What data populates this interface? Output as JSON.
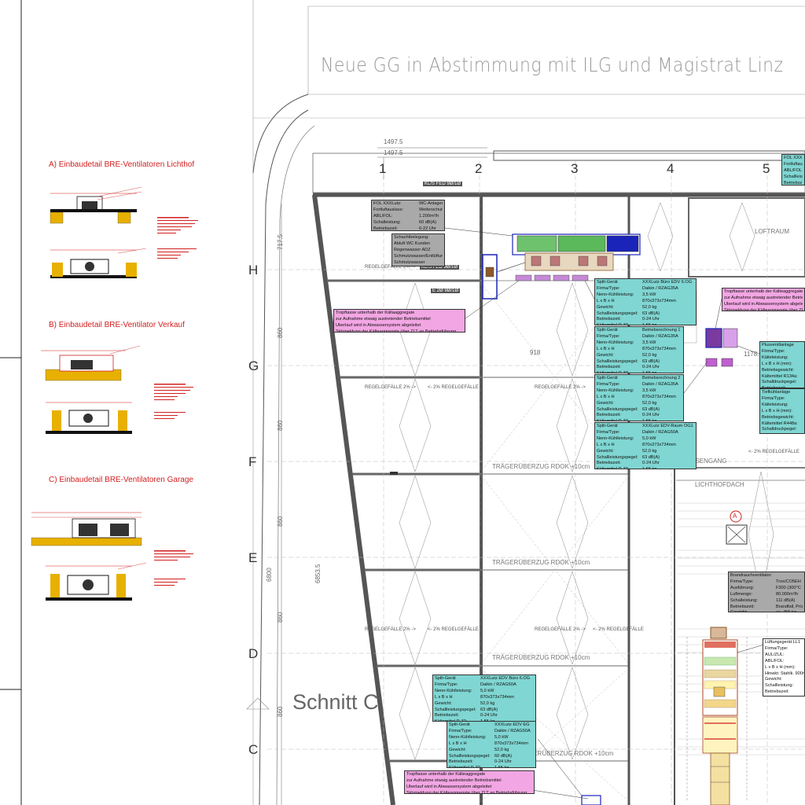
{
  "headline": "Neue GG in Abstimmung mit ILG und Magistrat Linz",
  "section_title": "Schnitt C",
  "details": [
    {
      "title": "A) Einbaudetail BRE-Ventilatoren Lichthof"
    },
    {
      "title": "B) Einbaudetail BRE-Ventilator Verkauf"
    },
    {
      "title": "C) Einbaudetail BRE-Ventilatoren Garage"
    }
  ],
  "grid_columns": [
    "1",
    "2",
    "3",
    "4",
    "5"
  ],
  "grid_rows": [
    "H",
    "G",
    "F",
    "E",
    "D",
    "C"
  ],
  "dimensions": {
    "top_a": "1497.5",
    "top_b": "1497.5",
    "left_a": "717.5",
    "left_b": "860",
    "left_c": "860",
    "left_d": "860",
    "left_e": "860",
    "left_f": "860",
    "left_total": "6800",
    "left_total2": "6853.5",
    "mid": "918",
    "right": "1178.5"
  },
  "labels": {
    "regel_left": "REGELGEFÄLLE 2% ->",
    "regel_right": "<- 2% REGELGEFÄLLE",
    "traeger1": "TRÄGERÜBERZUG RDOK +10cm",
    "traeger2": "TRÄGERÜBERZUG RDOK +10cm",
    "traeger3": "TRÄGERÜBERZUG RDOK +10cm",
    "traeger4": "TRÄGERÜBERZUG RDOK +10cm",
    "lichthof": "LICHTHOFDACH",
    "aussengang": "AUSSENGANG",
    "loftraum": "LOFTRAUM",
    "marker_a": "A",
    "tag_top": "KL/S  FED 9Ø/1Ø",
    "tag_mid": "KL/S  FED 9Ø/1Ø",
    "tag_low": "E 2Ø 9Ø/1Ø"
  },
  "boxes": {
    "fol_wc": {
      "rows": [
        [
          "FOL XXXLutz:",
          "WC-Anlagen"
        ],
        [
          "Fortluftauslass:",
          "Wetterschutzgitter"
        ],
        [
          "ABL/FOL:",
          "1.200m³/h"
        ],
        [
          "Schalleistung:",
          "60 dB(A)"
        ],
        [
          "Betriebszeit:",
          "6-22 Uhr"
        ]
      ]
    },
    "schacht": {
      "lines": [
        "Schachtbelegung:",
        "Abluft WC Kunden",
        "Regenwasser ADZ",
        "Schmutzwasser/Entlüftung",
        "Schmutzwasser"
      ]
    },
    "tropf_top": {
      "lines": [
        "Tropftasse unterhalb der Kältaaggregate",
        "zur Aufnahme etwaig austretender Betriebsmittel",
        "Überlauf wird in Abwassersystem abgeleitet",
        "Störmeldung der Kälteaggregate über ZLT an Betriebsführung"
      ]
    },
    "tropf_right": {
      "lines": [
        "Tropftasse unterhalb der Kälteaggregate",
        "zur Aufnahme etwaig austretender Betriebsmittel",
        "Überlauf wird in Abwassersystem abgeleitet",
        "Störmeldung der Kälteaggregate über ZLT an"
      ]
    },
    "tropf_bottom": {
      "lines": [
        "Tropftasse unterhalb der Kälteaggregate",
        "zur Aufnahme etwaig austretender Betriebsmittel",
        "Überlauf wird in Abwassersystem abgeleitet",
        "Störmeldung der Kälteaggregate über ZLT an Betriebsführung"
      ]
    },
    "split1": {
      "rows": [
        [
          "Split-Gerät",
          "XXXLutz Büro EDV 6.OG"
        ],
        [
          "Firma/Type:",
          "Daikin / RZAG35A"
        ],
        [
          "Nenn-Kühlleistung:",
          "3,5 kW"
        ],
        [
          "L x B x H",
          "870x373x734mm"
        ],
        [
          "Gewicht:",
          "52,0 kg"
        ],
        [
          "Schallleistungspegel:",
          "63 dB(A)"
        ],
        [
          "Betriebszeit:",
          "0-24 Uhr"
        ],
        [
          "Kältemittel R-32:",
          "1,55 kg"
        ]
      ]
    },
    "split2": {
      "rows": [
        [
          "Split-Gerät",
          "Betriebsrechnung 1"
        ],
        [
          "Firma/Type:",
          "Daikin / RZAG35A"
        ],
        [
          "Nenn-Kühlleistung:",
          "3,5 kW"
        ],
        [
          "L x B x H",
          "870x373x734mm"
        ],
        [
          "Gewicht:",
          "52,0 kg"
        ],
        [
          "Schallleistungspegel:",
          "63 dB(A)"
        ],
        [
          "Betriebszeit:",
          "0-24 Uhr"
        ],
        [
          "Kältemittel R-32:",
          "1,55 kg"
        ]
      ]
    },
    "split3": {
      "rows": [
        [
          "Split-Gerät",
          "Betriebsrechnung 2"
        ],
        [
          "Firma/Type:",
          "Daikin / RZAG35A"
        ],
        [
          "Nenn-Kühlleistung:",
          "3,5 kW"
        ],
        [
          "L x B x H",
          "870x373x734mm"
        ],
        [
          "Gewicht:",
          "52,0 kg"
        ],
        [
          "Schallleistungspegel:",
          "63 dB(A)"
        ],
        [
          "Betriebszeit:",
          "0-24 Uhr"
        ],
        [
          "Kältemittel R-32:",
          "1,55 kg"
        ]
      ]
    },
    "split4": {
      "rows": [
        [
          "Split-Gerät",
          "XXXLutz EDV-Raum OG1"
        ],
        [
          "Firma/Type:",
          "Daikin / RZAG50A"
        ],
        [
          "Nenn-Kühlleistung:",
          "5,0 kW"
        ],
        [
          "L x B x H",
          "870x373x734mm"
        ],
        [
          "Gewicht:",
          "52,0 kg"
        ],
        [
          "Schallleistungspegel:",
          "63 dB(A)"
        ],
        [
          "Betriebszeit:",
          "0-24 Uhr"
        ],
        [
          "Kältemittel R-32:",
          "1,55 kg"
        ]
      ]
    },
    "split5": {
      "rows": [
        [
          "Split-Gerät",
          "XXXLutz EDV Büro 6.OG"
        ],
        [
          "Firma/Type:",
          "Daikin / RZAG50A"
        ],
        [
          "Nenn-Kühlleistung:",
          "5,0 kW"
        ],
        [
          "L x B x H",
          "870x373x734mm"
        ],
        [
          "Gewicht:",
          "52,0 kg"
        ],
        [
          "Schallleistungspegel:",
          "63 dB(A)"
        ],
        [
          "Betriebszeit:",
          "0-24 Uhr"
        ],
        [
          "Kältemittel R-32:",
          "1,55 kg"
        ]
      ]
    },
    "split6": {
      "rows": [
        [
          "Split-Gerät",
          "XXXLutz EDV EG"
        ],
        [
          "Firma/Type:",
          "Daikin / RZAG50A"
        ],
        [
          "Nenn-Kühlleistung:",
          "5,0 kW"
        ],
        [
          "L x B x H",
          "870x373x734mm"
        ],
        [
          "Gewicht:",
          "52,0 kg"
        ],
        [
          "Schallleistungspegel:",
          "60 dB(A)"
        ],
        [
          "Betriebszeit:",
          "0-24 Uhr"
        ],
        [
          "Kältemittel R-32:",
          "1,55 kg"
        ]
      ]
    },
    "plusvent": {
      "rows": [
        [
          "Plusventilanlage",
          "X"
        ],
        [
          "Firma/Type:",
          ""
        ],
        [
          "Kälteleistung:",
          ""
        ],
        [
          "L x B x H (mm):",
          ""
        ],
        [
          "Betriebsgewicht:",
          ""
        ],
        [
          "Kältemittel R134a:",
          ""
        ],
        [
          "Schalldruckpegel:",
          ""
        ],
        [
          "Betriebszeit:",
          ""
        ]
      ]
    },
    "tiefkuehl": {
      "rows": [
        [
          "Tiefkühlanlage",
          ""
        ],
        [
          "Firma/Type:",
          ""
        ],
        [
          "Kälteleistung:",
          ""
        ],
        [
          "L x B x H (mm):",
          ""
        ],
        [
          "Betriebsgewicht:",
          ""
        ],
        [
          "Kältemittel R448a:",
          ""
        ],
        [
          "Schalldruckpegel:",
          ""
        ],
        [
          "Betriebszeit:",
          ""
        ]
      ]
    },
    "brandrauch": {
      "rows": [
        [
          "Brandrauchventilator:",
          ""
        ],
        [
          "Firma/Type:",
          "Trox/CO5EH"
        ],
        [
          "Ausführung:",
          "F300 (300°C"
        ],
        [
          "Luftmenge:",
          "80.000m³/h"
        ],
        [
          "Schalleistung:",
          "111 dB(A)"
        ],
        [
          "Betriebszeit:",
          "Brandfall, Prüf"
        ],
        [
          "Gewicht:",
          "ca. 455 kg"
        ]
      ]
    },
    "lueftung": {
      "rows": [
        [
          "Lüftungsgerät LL1",
          ""
        ],
        [
          "Firma/Type:",
          ""
        ],
        [
          "AUL/ZUL:",
          ""
        ],
        [
          "ABL/FOL:",
          ""
        ],
        [
          "L x B x H (mm):",
          ""
        ],
        [
          "Hinwkt: Stahlk. 900mm",
          ""
        ],
        [
          "Gewicht:",
          ""
        ],
        [
          "Schallleistung:",
          ""
        ],
        [
          "Betriebszeit:",
          ""
        ],
        [
          "Kontrollzeit:",
          ""
        ]
      ]
    },
    "fol_top_right": {
      "lines": [
        "FOL XXX",
        "Fortluftaus",
        "ABL/FOL",
        "Schallleist",
        "Betriebsz"
      ]
    }
  }
}
